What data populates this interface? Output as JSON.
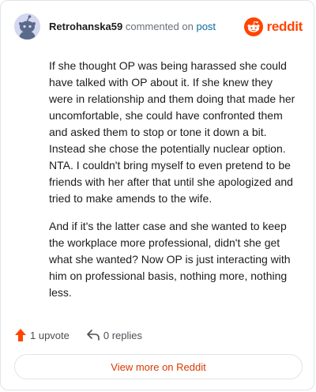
{
  "comment": {
    "username": "Retrohanska59",
    "commented_text": "commented on",
    "post_link": "post",
    "paragraphs": [
      "If she thought OP was being harassed she could have talked with OP about it. If she knew they were in relationship and them doing that made her uncomfortable, she could have confronted them and asked them to stop or tone it down a bit. Instead she chose the potentially nuclear option. NTA. I couldn't bring myself to even pretend to be friends with her after that until she apologized and tried to make amends to the wife.",
      "And if it's the latter case and she wanted to keep the workplace more professional, didn't she get what she wanted? Now OP is just interacting with him on professional basis, nothing more, nothing less."
    ]
  },
  "brand": {
    "name": "reddit",
    "accent": "#ff4500"
  },
  "actions": {
    "upvote_label": "1 upvote",
    "replies_label": "0 replies"
  },
  "footer": {
    "view_more_label": "View more on Reddit"
  },
  "colors": {
    "link": "#0a6a9e",
    "view_more": "#d93a00",
    "border": "#e2e4e7"
  },
  "icons": {
    "avatar": "snoo-avatar-icon",
    "logo": "reddit-logo-icon",
    "upvote": "upvote-arrow-icon",
    "reply": "reply-arrow-icon"
  }
}
